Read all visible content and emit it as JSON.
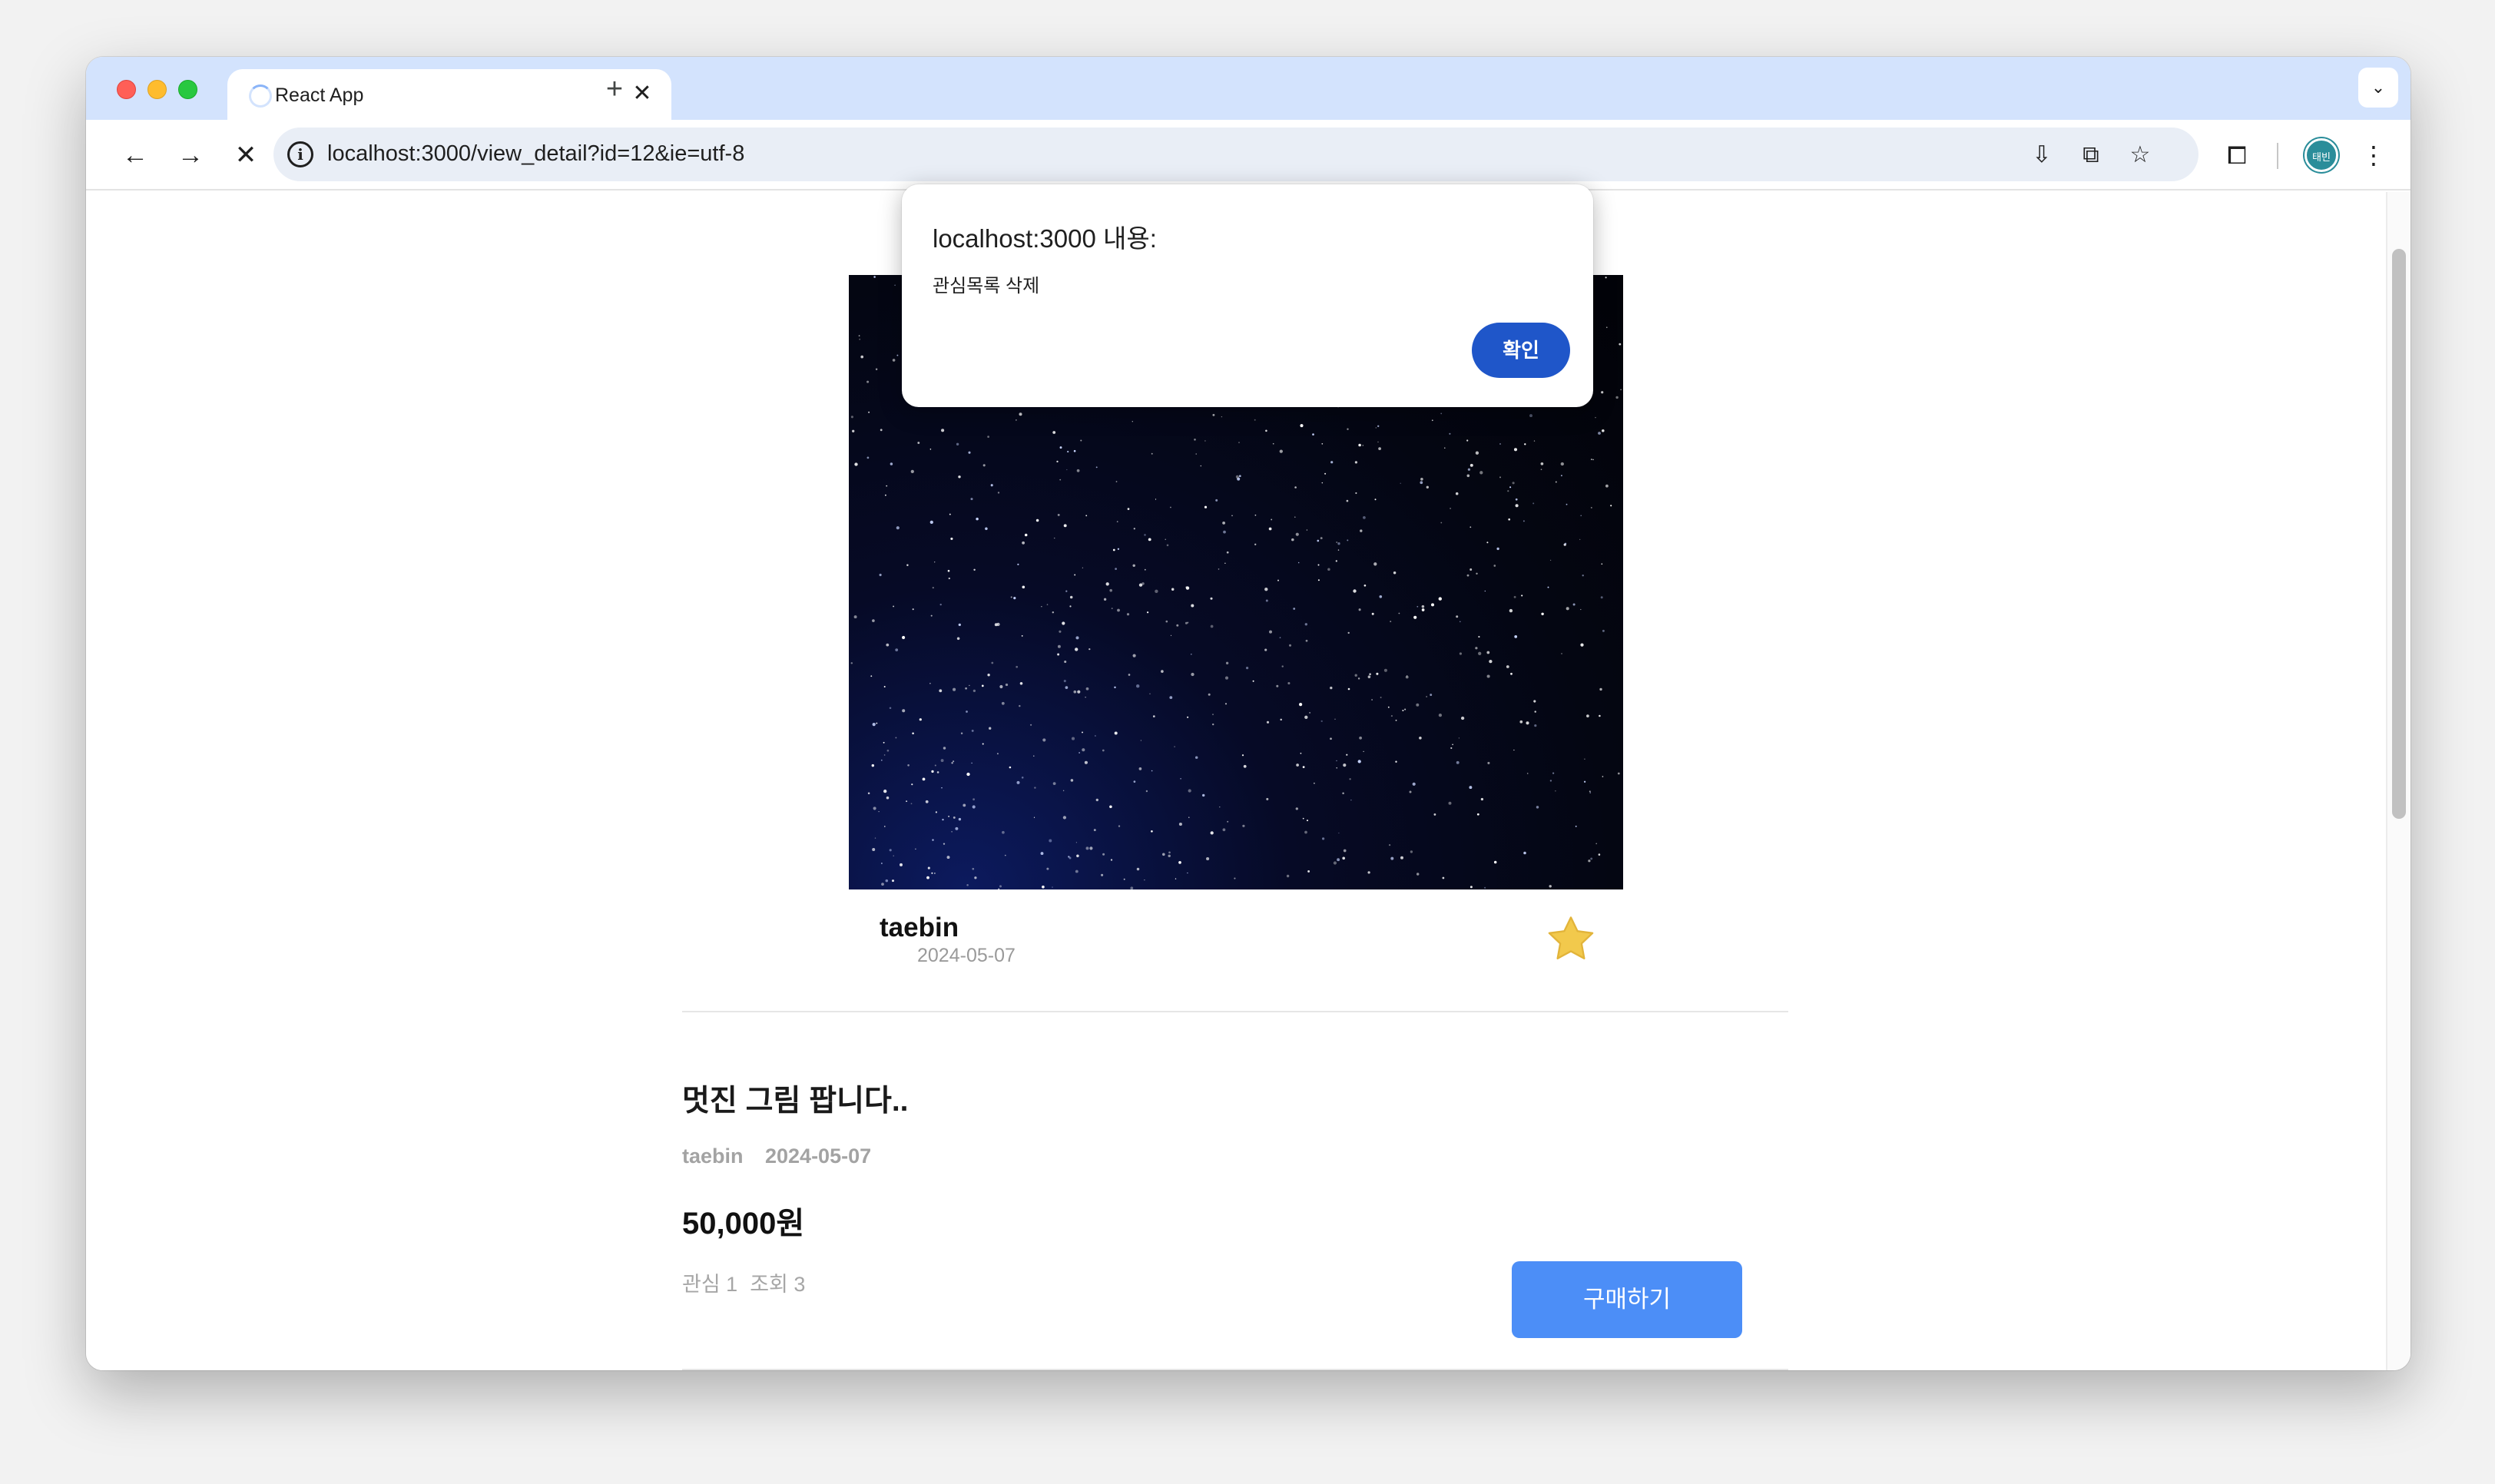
{
  "browser": {
    "tab": {
      "title": "React App",
      "close_glyph": "✕",
      "loading": true
    },
    "new_tab_glyph": "+",
    "tab_search_glyph": "⌄",
    "nav": {
      "back_glyph": "←",
      "forward_glyph": "→",
      "stop_glyph": "✕"
    },
    "address_bar": {
      "info_glyph": "i",
      "url": "localhost:3000/view_detail?id=12&ie=utf-8"
    },
    "icons": {
      "install": "install-app-icon",
      "translate": "translate-icon",
      "bookmark": "bookmark-star-icon",
      "extensions": "extensions-puzzle-icon",
      "menu": "more-vert-icon"
    },
    "glyphs": {
      "install": "⇩",
      "translate": "⧉",
      "bookmark": "☆",
      "extensions": "⧠",
      "menu": "⋮"
    },
    "profile": {
      "initials": "태빈",
      "color": "#2a8d9a"
    }
  },
  "alert": {
    "title": "localhost:3000 내용:",
    "message": "관심목록 삭제",
    "ok_label": "확인",
    "ok_color": "#1f56c9"
  },
  "product": {
    "image_icon": "starry-night-sky-image",
    "seller": {
      "name": "taebin",
      "date": "2024-05-07"
    },
    "favorite": {
      "icon": "star-filled-icon",
      "active": true,
      "color": "#f2c94c"
    },
    "post": {
      "title": "멋진 그림 팝니다..",
      "author": "taebin",
      "date": "2024-05-07",
      "price": "50,000원",
      "likes_label": "관심 1",
      "views_label": "조회 3"
    },
    "buy_label": "구매하기",
    "buy_color": "#4c8ef7"
  }
}
